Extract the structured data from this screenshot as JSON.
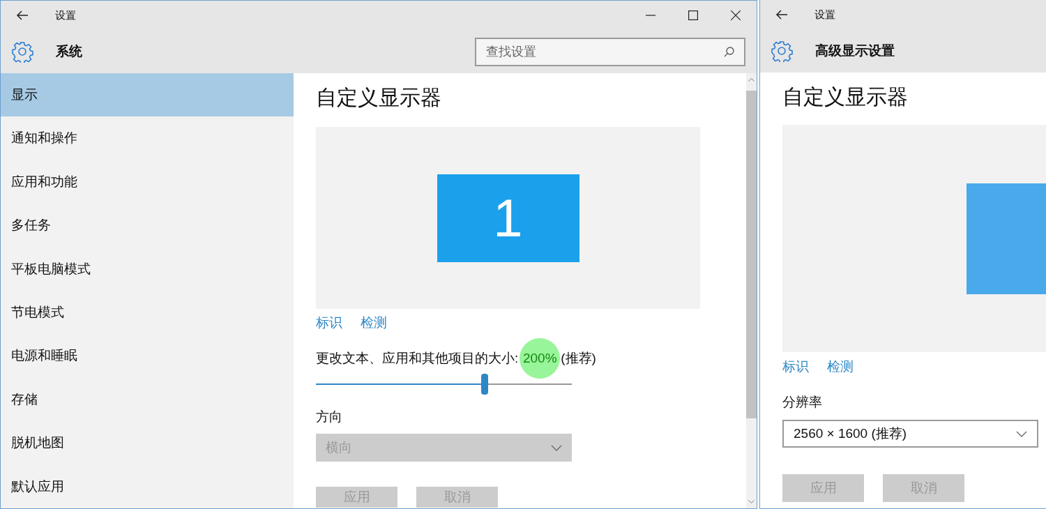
{
  "windows": [
    {
      "title_bar": {
        "title": "设置",
        "window_controls": true
      },
      "header": {
        "title": "系统"
      },
      "search": {
        "placeholder": "查找设置"
      },
      "sidebar": {
        "items": [
          {
            "label": "显示",
            "selected": true
          },
          {
            "label": "通知和操作",
            "selected": false
          },
          {
            "label": "应用和功能",
            "selected": false
          },
          {
            "label": "多任务",
            "selected": false
          },
          {
            "label": "平板电脑模式",
            "selected": false
          },
          {
            "label": "节电模式",
            "selected": false
          },
          {
            "label": "电源和睡眠",
            "selected": false
          },
          {
            "label": "存储",
            "selected": false
          },
          {
            "label": "脱机地图",
            "selected": false
          },
          {
            "label": "默认应用",
            "selected": false
          }
        ]
      },
      "content": {
        "heading": "自定义显示器",
        "monitor": {
          "label": "1",
          "cropped": false
        },
        "links": [
          "标识",
          "检测"
        ],
        "scale": {
          "label": "更改文本、应用和其他项目的大小:",
          "value": "200%",
          "note": "(推荐)",
          "highlighted": true,
          "level": 0.66
        },
        "orientation": {
          "label": "方向",
          "value": "横向",
          "disabled": true
        },
        "buttons": [
          {
            "label": "应用",
            "disabled": true
          },
          {
            "label": "取消",
            "disabled": true
          }
        ]
      },
      "scrollbar": true
    },
    {
      "title_bar": {
        "title": "设置"
      },
      "header": {
        "title": "高级显示设置"
      },
      "content": {
        "heading": "自定义显示器",
        "monitor": {
          "cropped": true
        },
        "links": [
          "标识",
          "检测"
        ],
        "resolution": {
          "label": "分辨率",
          "value": "2560 × 1600 (推荐)",
          "disabled": false
        },
        "buttons": [
          {
            "label": "应用",
            "disabled": true
          },
          {
            "label": "取消",
            "disabled": true
          }
        ]
      }
    }
  ]
}
